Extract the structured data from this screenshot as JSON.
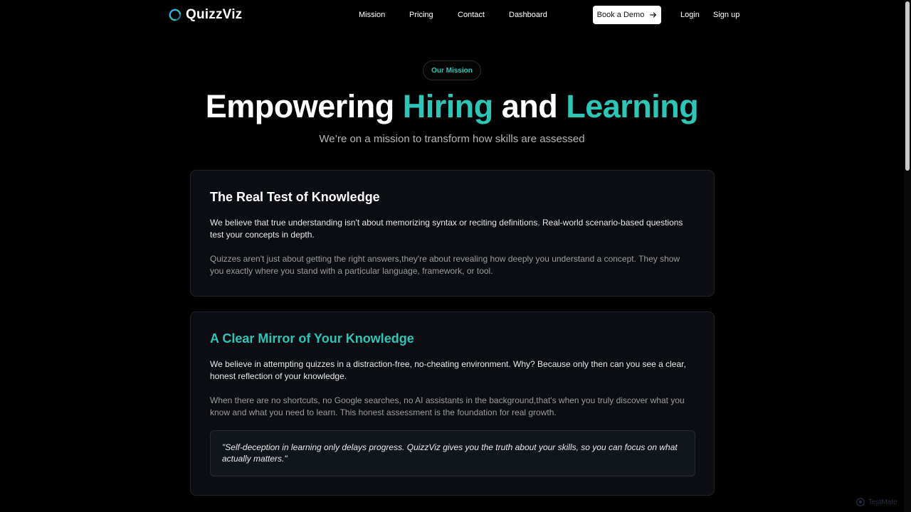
{
  "brand": {
    "name": "QuizzViz",
    "logo_icon": "circular-arrows-logo",
    "accent_color": "#2ec4b6"
  },
  "nav": {
    "links": [
      "Mission",
      "Pricing",
      "Contact",
      "Dashboard"
    ],
    "demo_button": "Book a Demo",
    "login": "Login",
    "signup": "Sign up"
  },
  "hero": {
    "pill": "Our Mission",
    "title_part1": "Empowering ",
    "title_accent1": "Hiring",
    "title_part2": " and ",
    "title_accent2": "Learning",
    "subtitle": "We’re on a mission to transform how skills are assessed"
  },
  "cards": [
    {
      "title": "The Real Test of Knowledge",
      "paragraphs": [
        "We believe that true understanding isn't about memorizing syntax or reciting definitions. Real-world scenario-based questions test your concepts in depth.",
        "Quizzes aren't just about getting the right answers,they're about revealing how deeply you understand a concept. They show you exactly where you stand with a particular language, framework, or tool."
      ]
    },
    {
      "title": "A Clear Mirror of Your Knowledge",
      "paragraphs": [
        "We believe in attempting quizzes in a distraction-free, no-cheating environment. Why? Because only then can you see a clear, honest reflection of your knowledge.",
        "When there are no shortcuts, no Google searches, no AI assistants in the background,that's when you truly discover what you know and what you need to learn. This honest assessment is the foundation for real growth."
      ],
      "quote": "\"Self-deception in learning only delays progress. QuizzViz gives you the truth about your skills, so you can focus on what actually matters.\""
    }
  ],
  "watermark": {
    "icon": "gear-logo-icon",
    "text": "TestMate"
  }
}
